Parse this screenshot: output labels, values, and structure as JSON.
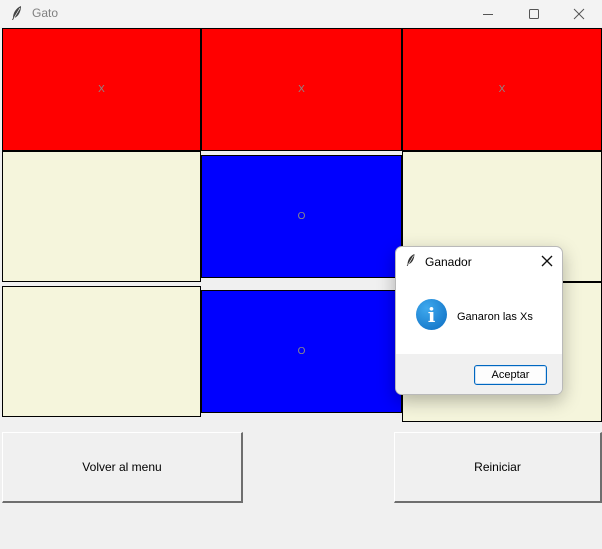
{
  "window": {
    "title": "Gato",
    "icon": "feather-icon",
    "controls": [
      "minimize-icon",
      "maximize-icon",
      "close-icon"
    ]
  },
  "board": {
    "cells": [
      "X",
      "X",
      "X",
      "",
      "O",
      "",
      "",
      "O",
      ""
    ],
    "colors": {
      "x_cell": "#ff0000",
      "o_cell": "#0000ff",
      "empty_cell": "#f5f5dc"
    }
  },
  "buttons": {
    "back": "Volver al menu",
    "restart": "Reiniciar"
  },
  "dialog": {
    "title": "Ganador",
    "icon": "info-icon",
    "message": "Ganaron las Xs",
    "ok": "Aceptar"
  }
}
